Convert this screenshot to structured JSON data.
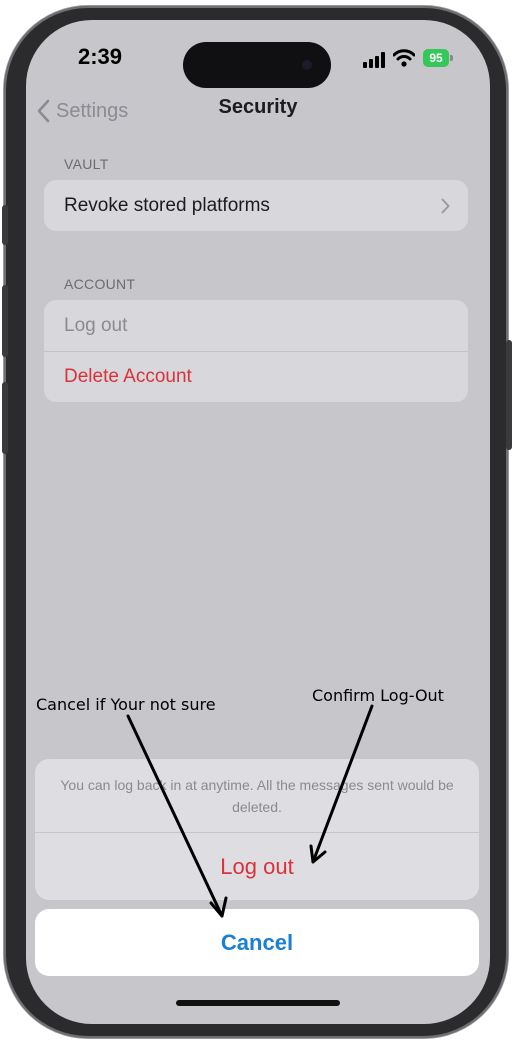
{
  "status_bar": {
    "time": "2:39",
    "battery_level": "95",
    "battery_color": "#34c759"
  },
  "nav": {
    "back_label": "Settings",
    "title": "Security"
  },
  "sections": {
    "vault": {
      "header": "VAULT",
      "items": [
        "Revoke stored platforms"
      ]
    },
    "account": {
      "header": "ACCOUNT",
      "items": [
        "Log out",
        "Delete Account"
      ]
    }
  },
  "action_sheet": {
    "message": "You can log back in at anytime. All the messages sent would be deleted.",
    "confirm_label": "Log out",
    "cancel_label": "Cancel"
  },
  "annotations": {
    "cancel_note": "Cancel if Your not sure",
    "confirm_note": "Confirm Log-Out"
  },
  "colors": {
    "destructive": "#d8333a",
    "accent": "#1a7fd6"
  }
}
